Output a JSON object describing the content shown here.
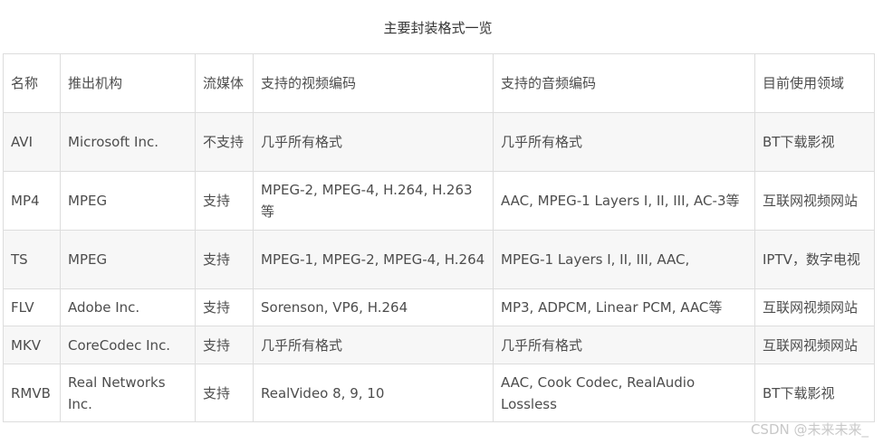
{
  "caption": "主要封装格式一览",
  "table": {
    "headers": [
      "名称",
      "推出机构",
      "流媒体",
      "支持的视频编码",
      "支持的音频编码",
      "目前使用领域"
    ],
    "rows": [
      [
        "AVI",
        "Microsoft Inc.",
        "不支持",
        "几乎所有格式",
        "几乎所有格式",
        "BT下载影视"
      ],
      [
        "MP4",
        "MPEG",
        "支持",
        "MPEG-2, MPEG-4, H.264, H.263等",
        "AAC, MPEG-1 Layers I, II, III, AC-3等",
        "互联网视频网站"
      ],
      [
        "TS",
        "MPEG",
        "支持",
        "MPEG-1, MPEG-2, MPEG-4, H.264",
        "MPEG-1 Layers I, II, III, AAC,",
        "IPTV，数字电视"
      ],
      [
        "FLV",
        "Adobe Inc.",
        "支持",
        "Sorenson, VP6, H.264",
        "MP3, ADPCM, Linear PCM, AAC等",
        "互联网视频网站"
      ],
      [
        "MKV",
        "CoreCodec Inc.",
        "支持",
        "几乎所有格式",
        "几乎所有格式",
        "互联网视频网站"
      ],
      [
        "RMVB",
        "Real Networks Inc.",
        "支持",
        "RealVideo 8, 9, 10",
        "AAC, Cook Codec, RealAudio Lossless",
        "BT下载影视"
      ]
    ]
  },
  "watermark": "CSDN @未来未来_"
}
